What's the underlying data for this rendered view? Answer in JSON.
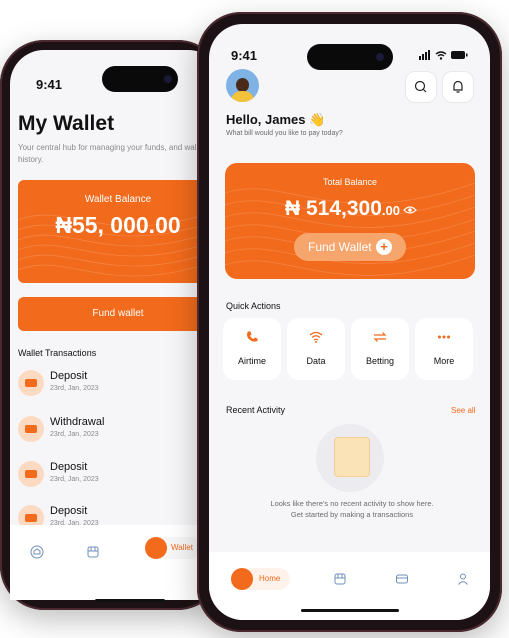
{
  "back_phone": {
    "status_time": "9:41",
    "title": "My Wallet",
    "subtitle": "Your central hub for managing your funds, and wallet history.",
    "balance_label": "Wallet Balance",
    "balance_amount": "₦55, 000.00",
    "fund_button": "Fund wallet",
    "transactions_title": "Wallet Transactions",
    "transactions": [
      {
        "name": "Deposit",
        "date": "23rd, Jan, 2023"
      },
      {
        "name": "Withdrawal",
        "date": "23rd, Jan, 2023"
      },
      {
        "name": "Deposit",
        "date": "23rd, Jan, 2023"
      },
      {
        "name": "Deposit",
        "date": "23rd, Jan, 2023"
      }
    ],
    "nav_active_label": "Wallet"
  },
  "front_phone": {
    "status_time": "9:41",
    "greeting": "Hello, James 👋",
    "greeting_sub": "What bill would you like to pay today?",
    "balance_label": "Total Balance",
    "balance_main": "₦ 514,300",
    "balance_decimal": ".00",
    "fund_button": "Fund Wallet",
    "quick_actions_title": "Quick Actions",
    "quick_actions": [
      {
        "label": "Airtime",
        "icon": "phone-icon"
      },
      {
        "label": "Data",
        "icon": "wifi-icon"
      },
      {
        "label": "Betting",
        "icon": "swap-icon"
      },
      {
        "label": "More",
        "icon": "more-icon"
      }
    ],
    "recent_title": "Recent Activity",
    "see_all": "See all",
    "empty_text": "Looks like there's no recent activity to show here. Get started by making a transactions",
    "nav_active_label": "Home"
  },
  "colors": {
    "accent": "#f26a1b",
    "background": "#f6f6f8"
  }
}
